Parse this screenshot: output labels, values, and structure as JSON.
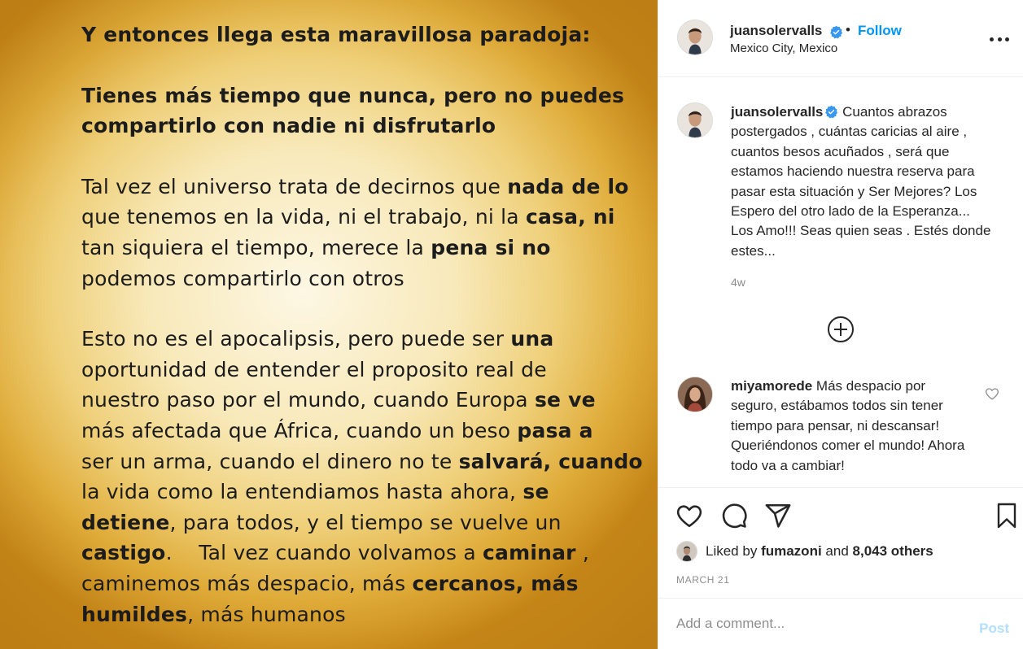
{
  "image_text": {
    "line1": "Y entonces llega esta maravillosa paradoja",
    "p1_l1_a": "Tienes más tiempo que nunca, pero no ",
    "p1_l1_b": "puedes",
    "p1_l2": "compartirlo con nadie ni disfrutarlo",
    "p2_l1_a": "Tal vez el universo trata de decirnos que ",
    "p2_l1_b": "nada de lo",
    "p2_l2_a": "que tenemos en la vida, ni el trabajo, ni la ",
    "p2_l2_b": "casa, ni",
    "p2_l3_a": "tan siquiera el tiempo, merece la ",
    "p2_l3_b": "pena si no",
    "p2_l4": "podemos compartirlo con otros",
    "p3_l1_a": "Esto no es el apocalipsis, pero puede ser ",
    "p3_l1_b": "una",
    "p3_l2": "oportunidad de entender el proposito real de",
    "p3_l3_a": "nuestro paso por el mundo, cuando Europa ",
    "p3_l3_b": "se ve",
    "p3_l4_a": "más afectada que África, cuando un beso ",
    "p3_l4_b": "pasa a",
    "p3_l5_a": "ser un arma, cuando el dinero no te ",
    "p3_l5_b": "salvará, cuando",
    "p3_l6_a": "la vida como la entendiamos hasta ahora, ",
    "p3_l6_b": "se",
    "p3_l7_a": "detiene",
    "p3_l7_b": ", para todos, y el tiempo se vuelve un",
    "p3_l8_a": "castigo",
    "p3_l8_b": ".    Tal vez cuando volvamos a ",
    "p3_l8_c": "caminar",
    "p3_l8_d": " ,",
    "p3_l9_a": "caminemos más despacio, más ",
    "p3_l9_b": "cercanos, más",
    "p3_l10_a": "humildes",
    "p3_l10_b": ", más humanos"
  },
  "header": {
    "username": "juansolervalls",
    "dot": "•",
    "follow": "Follow",
    "location": "Mexico City, Mexico"
  },
  "caption": {
    "username": "juansolervalls",
    "text": "Cuantos abrazos postergados , cuántas caricias al aire , cuantos besos acuñados , será que estamos haciendo nuestra reserva para pasar esta situación y Ser Mejores? Los Espero del otro lado de la Esperanza... Los Amo!!! Seas quien seas . Estés donde estes...",
    "time": "4w"
  },
  "comment": {
    "username": "miyamorede",
    "text": "Más despacio por seguro, estábamos todos sin tener tiempo para pensar, ni descansar! Queriéndonos comer el mundo! Ahora todo va a cambiar!"
  },
  "likes": {
    "prefix": "Liked by",
    "user": "fumazoni",
    "and": "and",
    "others": "8,043 others"
  },
  "date": "MARCH 21",
  "add_comment": {
    "placeholder": "Add a comment...",
    "post": "Post"
  },
  "colors": {
    "link_blue": "#0095f6",
    "post_disabled": "#b2dffc",
    "secondary_text": "#8e8e8e"
  },
  "icons": [
    "more-options-icon",
    "verified-badge-icon",
    "load-more-icon",
    "heart-icon",
    "comment-icon",
    "share-icon",
    "bookmark-icon"
  ]
}
